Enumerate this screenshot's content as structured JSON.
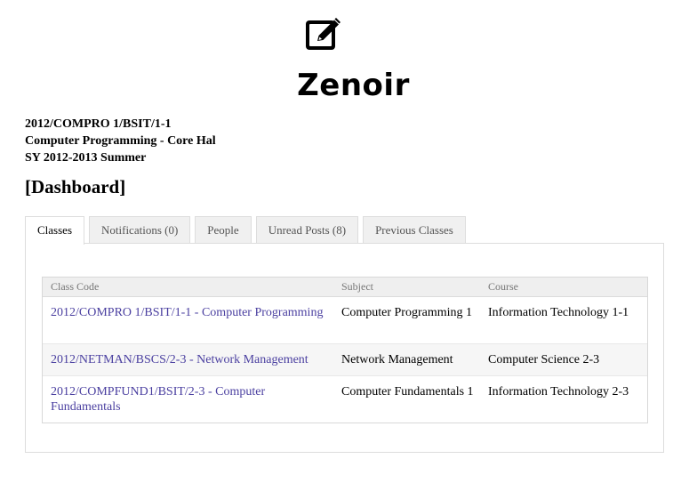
{
  "app": {
    "logo_icon": "edit-pen-square-icon",
    "title": "Zenoir"
  },
  "class_info": {
    "code": "2012/COMPRO 1/BSIT/1-1",
    "subject_line": "Computer Programming - Core Hal",
    "term": "SY 2012-2013 Summer"
  },
  "page_title": "[Dashboard]",
  "tabs": [
    {
      "label": "Classes",
      "active": true
    },
    {
      "label": "Notifications (0)",
      "active": false
    },
    {
      "label": "People",
      "active": false
    },
    {
      "label": "Unread Posts (8)",
      "active": false
    },
    {
      "label": "Previous Classes",
      "active": false
    }
  ],
  "classes_table": {
    "headers": [
      "Class Code",
      "Subject",
      "Course"
    ],
    "rows": [
      {
        "class_code": "2012/COMPRO 1/BSIT/1-1 - Computer Programming",
        "subject": "Computer Programming 1",
        "course": "Information Technology 1-1"
      },
      {
        "class_code": "2012/NETMAN/BSCS/2-3 - Network Management",
        "subject": "Network Management",
        "course": "Computer Science 2-3"
      },
      {
        "class_code": "2012/COMPFUND1/BSIT/2-3 - Computer Fundamentals",
        "subject": "Computer Fundamentals 1",
        "course": "Information Technology 2-3"
      }
    ]
  },
  "colors": {
    "link": "#4a3fa0",
    "tab_inactive_bg": "#f0f0f0",
    "table_header_bg": "#efefef"
  }
}
